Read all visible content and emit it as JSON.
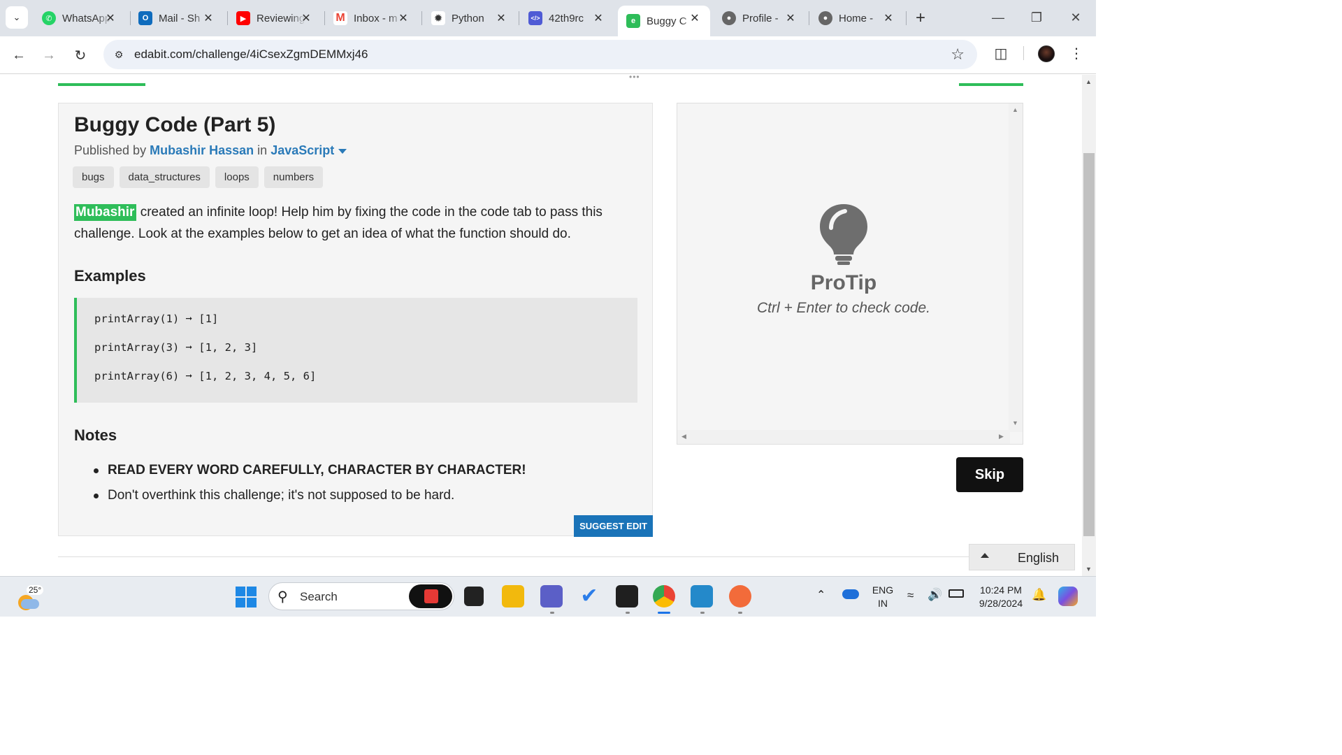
{
  "tabs": [
    {
      "label": "WhatsApp",
      "icon": "whatsapp-icon",
      "color": "#25d366"
    },
    {
      "label": "Mail - Sh",
      "icon": "outlook-icon",
      "color": "#0f6cbd"
    },
    {
      "label": "Reviewing",
      "icon": "youtube-icon",
      "color": "#ff0000"
    },
    {
      "label": "Inbox - m",
      "icon": "gmail-icon",
      "color": "#ea4335"
    },
    {
      "label": "Python",
      "icon": "chatgpt-icon",
      "color": "#333333"
    },
    {
      "label": "42th9rc",
      "icon": "code-icon",
      "color": "#4f5bd5"
    },
    {
      "label": "Buggy C",
      "icon": "edabit-icon",
      "color": "#2ebd59"
    },
    {
      "label": "Profile -",
      "icon": "globe-icon",
      "color": "#666666"
    },
    {
      "label": "Home -",
      "icon": "globe-icon",
      "color": "#666666"
    }
  ],
  "toolbar": {
    "url": "edabit.com/challenge/4iCsexZgmDEMMxj46"
  },
  "challenge": {
    "title": "Buggy Code (Part 5)",
    "published_by": "Published by",
    "author": "Mubashir Hassan",
    "in": "in",
    "language": "JavaScript",
    "tags": [
      "bugs",
      "data_structures",
      "loops",
      "numbers"
    ],
    "desc_highlight": "Mubashir",
    "desc_rest": " created an infinite loop! Help him by fixing the code in the code tab to pass this challenge. Look at the examples below to get an idea of what the function should do.",
    "examples_heading": "Examples",
    "examples": [
      "printArray(1) ➞ [1]",
      "printArray(3) ➞ [1, 2, 3]",
      "printArray(6) ➞ [1, 2, 3, 4, 5, 6]"
    ],
    "notes_heading": "Notes",
    "notes": [
      "READ EVERY WORD CAREFULLY, CHARACTER BY CHARACTER!",
      "Don't overthink this challenge; it's not supposed to be hard."
    ],
    "suggest_edit": "SUGGEST EDIT"
  },
  "protip": {
    "title": "ProTip",
    "text": "Ctrl + Enter to check code."
  },
  "skip_label": "Skip",
  "language_selector": "English",
  "taskbar": {
    "temperature": "25°",
    "search_placeholder": "Search",
    "lang_line1": "ENG",
    "lang_line2": "IN",
    "time": "10:24 PM",
    "date": "9/28/2024"
  },
  "colors": {
    "accent_green": "#2ebd59",
    "link_blue": "#2a7ab8",
    "button_blue": "#1a73b8"
  }
}
